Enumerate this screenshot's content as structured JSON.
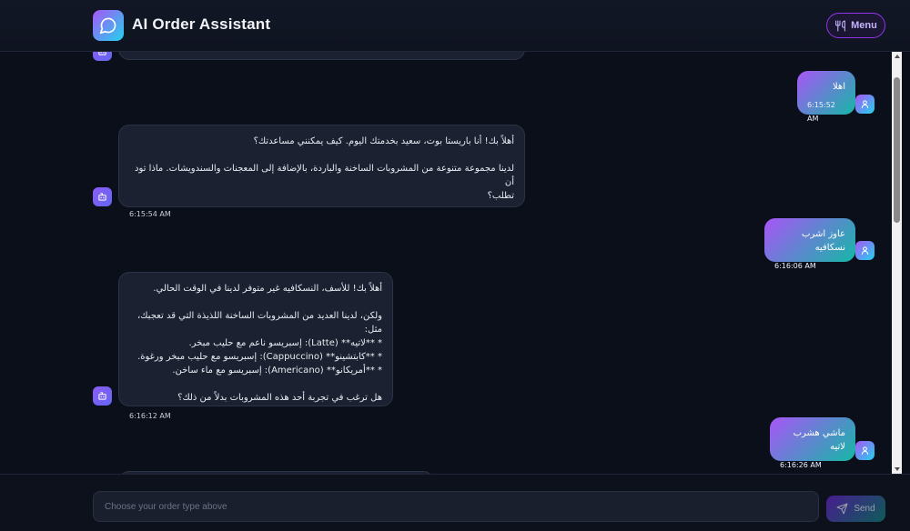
{
  "header": {
    "title": "AI Order Assistant",
    "menu_label": "Menu"
  },
  "messages": [
    {
      "role": "user",
      "lines": [
        "اهلا"
      ],
      "time": "6:15:52 AM"
    },
    {
      "role": "bot",
      "lines": [
        "أهلاً بك! أنا باريستا بوت، سعيد بخدمتك اليوم. كيف يمكنني مساعدتك؟",
        "",
        "لدينا مجموعة متنوعة من المشروبات الساخنة والباردة، بالإضافة إلى المعجنات والسندويشات. ماذا تود أن",
        "تطلب؟"
      ],
      "time": "6:15:54 AM"
    },
    {
      "role": "user",
      "lines": [
        "عاوز اشرب نسكافيه"
      ],
      "time": "6:16:06 AM"
    },
    {
      "role": "bot",
      "lines": [
        "أهلاً بك! للأسف، النسكافيه غير متوفر لدينا في الوقت الحالي.",
        "",
        "ولكن، لدينا العديد من المشروبات الساخنة اللذيذة التي قد تعجبك، مثل:",
        "* **لاتيه** (Latte): إسبريسو ناعم مع حليب مبخر.",
        "* **كابتشينو** (Cappuccino): إسبريسو مع حليب مبخر ورغوة.",
        "* **أمريكانو** (Americano): إسبريسو مع ماء ساخن.",
        "",
        "هل ترغب في تجربة أحد هذه المشروبات بدلاً من ذلك؟"
      ],
      "time": "6:16:12 AM"
    },
    {
      "role": "user",
      "lines": [
        "ماشي هشرب لاتيه"
      ],
      "time": "6:16:26 AM"
    }
  ],
  "input": {
    "placeholder": "Choose your order type above",
    "value": ""
  },
  "send_label": "Send",
  "colors": {
    "accent_purple": "#a855f7",
    "accent_teal": "#14b8a6",
    "background": "#0b0f1a",
    "bot_bubble": "#1b2130"
  }
}
